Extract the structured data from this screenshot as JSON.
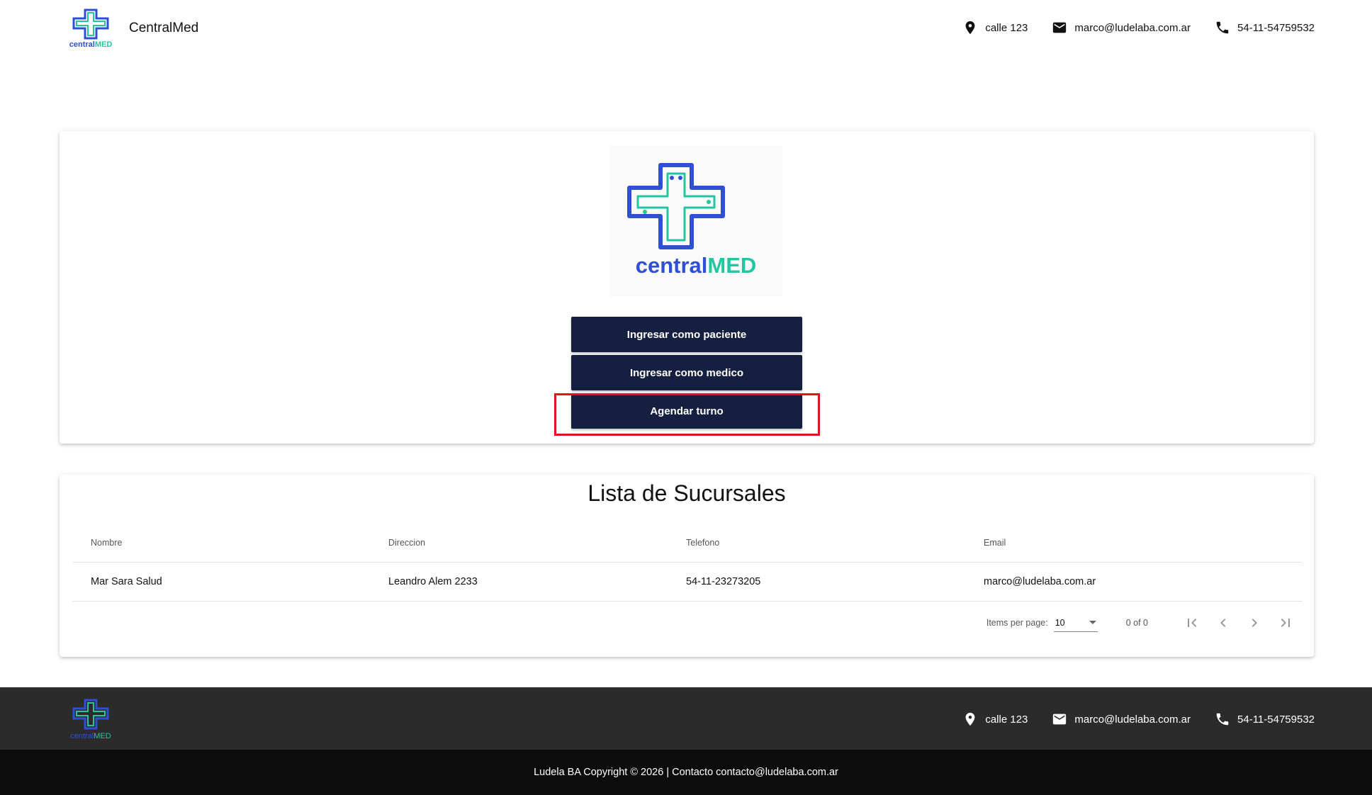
{
  "header": {
    "brand_name": "CentralMed",
    "logo_text_central": "central",
    "logo_text_med": "MED",
    "contacts": {
      "address": "calle 123",
      "email": "marco@ludelaba.com.ar",
      "phone": "54-11-54759532"
    }
  },
  "hero": {
    "logo_text_central": "central",
    "logo_text_med": "MED",
    "buttons": {
      "patient": "Ingresar como paciente",
      "doctor": "Ingresar como medico",
      "appointment": "Agendar turno"
    }
  },
  "branches": {
    "title": "Lista de Sucursales",
    "columns": [
      "Nombre",
      "Direccion",
      "Telefono",
      "Email"
    ],
    "rows": [
      [
        "Mar Sara Salud",
        "Leandro Alem 2233",
        "54-11-23273205",
        "marco@ludelaba.com.ar"
      ]
    ],
    "paginator": {
      "items_per_page_label": "Items per page:",
      "items_per_page_value": "10",
      "range_label": "0 of 0"
    }
  },
  "footer": {
    "logo_text_central": "central",
    "logo_text_med": "MED",
    "contacts": {
      "address": "calle 123",
      "email": "marco@ludelaba.com.ar",
      "phone": "54-11-54759532"
    },
    "copyright": "Ludela BA Copyright © 2026 | Contacto contacto@ludelaba.com.ar"
  },
  "colors": {
    "button_bg": "#152040",
    "logo_blue": "#2f4fd6",
    "logo_green": "#22c7a0",
    "highlight": "#e0141c",
    "footer_top": "#2b2b2b",
    "footer_bottom": "#0c0c0c"
  }
}
